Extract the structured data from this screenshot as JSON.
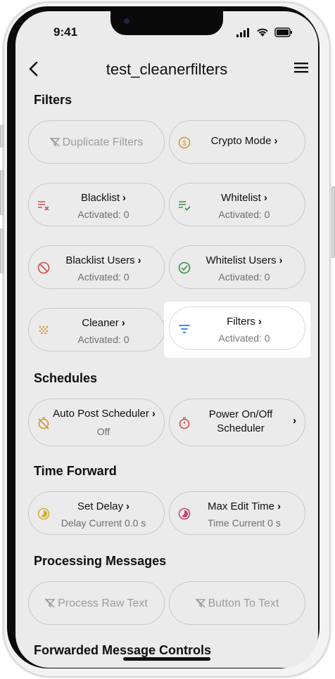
{
  "status": {
    "time": "9:41"
  },
  "appbar": {
    "title": "test_cleanerfilters"
  },
  "sections": {
    "filters": "Filters",
    "schedules": "Schedules",
    "time_forward": "Time Forward",
    "processing": "Processing Messages",
    "forwarded": "Forwarded Message Controls"
  },
  "buttons": {
    "duplicate_filters": "Duplicate Filters",
    "crypto_mode": "Crypto Mode",
    "blacklist": {
      "label": "Blacklist",
      "status": "Activated: 0"
    },
    "whitelist": {
      "label": "Whitelist",
      "status": "Activated: 0"
    },
    "blacklist_users": {
      "label": "Blacklist Users",
      "status": "Activated: 0"
    },
    "whitelist_users": {
      "label": "Whitelist Users",
      "status": "Activated: 0"
    },
    "cleaner": {
      "label": "Cleaner",
      "status": "Activated: 0"
    },
    "filters": {
      "label": "Filters",
      "status": "Activated: 0"
    },
    "auto_post": {
      "label": "Auto Post Scheduler",
      "status": "Off"
    },
    "power_onoff": {
      "line1": "Power On/Off",
      "line2": "Scheduler"
    },
    "set_delay": {
      "label": "Set Delay",
      "status": "Delay Current 0.0 s"
    },
    "max_edit": {
      "label": "Max Edit Time",
      "status": "Time Current 0 s"
    },
    "process_raw": "Process Raw Text",
    "button_to_text": "Button To Text"
  },
  "chevron": "›",
  "colors": {
    "red": "#e05656",
    "green": "#3f9b50",
    "blue": "#2f7bd6",
    "orange": "#e0a53a",
    "yellow": "#e4c13a",
    "pink": "#d64a72"
  }
}
